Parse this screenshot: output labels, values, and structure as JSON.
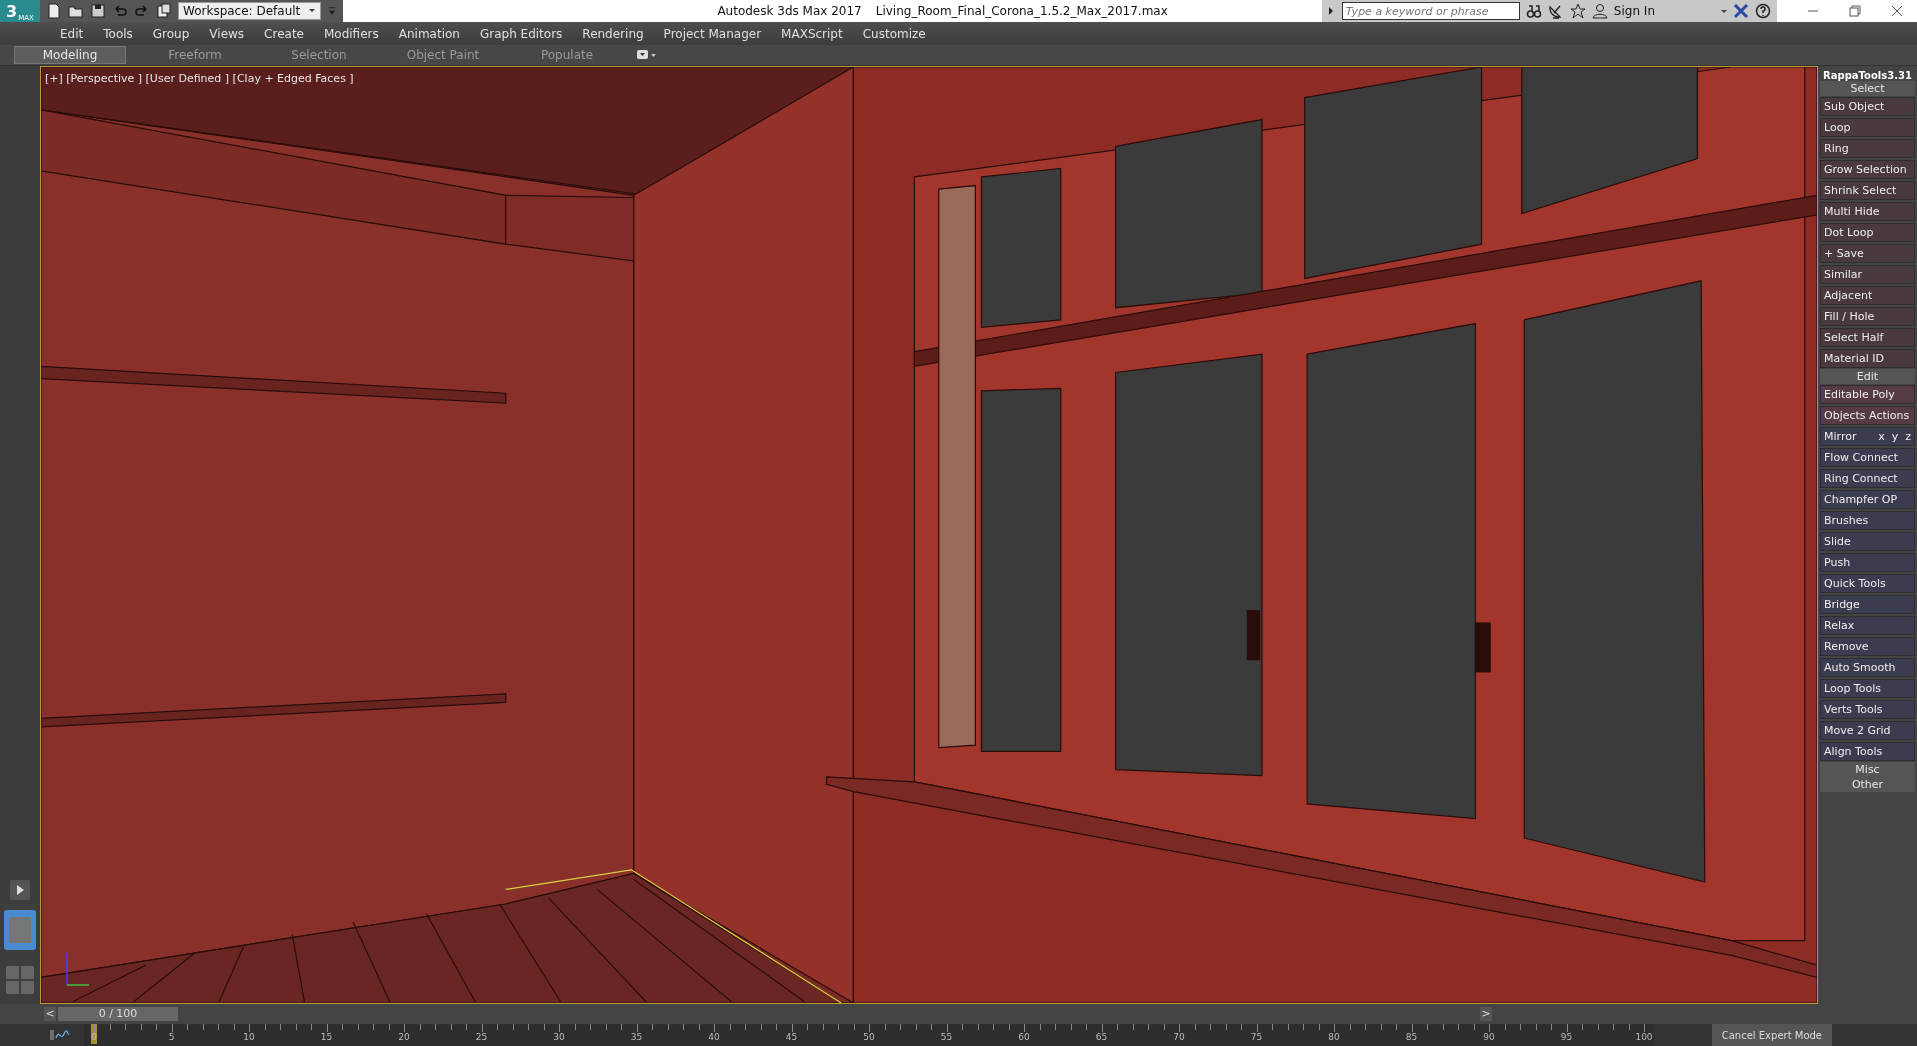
{
  "logo": {
    "numeral": "3",
    "word": "MAX"
  },
  "workspace": {
    "value": "Workspace: Default"
  },
  "title": {
    "app": "Autodesk 3ds Max 2017",
    "file": "Living_Room_Final_Corona_1.5.2_Max_2017.max"
  },
  "search": {
    "placeholder": "Type a keyword or phrase"
  },
  "sign_in": "Sign In",
  "menu": [
    "Edit",
    "Tools",
    "Group",
    "Views",
    "Create",
    "Modifiers",
    "Animation",
    "Graph Editors",
    "Rendering",
    "Project Manager",
    "MAXScript",
    "Customize"
  ],
  "ribbon_tabs": [
    {
      "label": "Modeling",
      "selected": true
    },
    {
      "label": "Freeform",
      "selected": false
    },
    {
      "label": "Selection",
      "selected": false
    },
    {
      "label": "Object Paint",
      "selected": false
    },
    {
      "label": "Populate",
      "selected": false
    }
  ],
  "viewport": {
    "label": "[+] [Perspective ] [User Defined ] [Clay + Edged Faces ]"
  },
  "panel": {
    "title": "RappaTools3.31",
    "items": [
      {
        "kind": "header",
        "label": "Select"
      },
      {
        "kind": "button",
        "label": "Sub Object",
        "color": "#4a3a40"
      },
      {
        "kind": "button",
        "label": "Loop",
        "color": "#4a3a40"
      },
      {
        "kind": "button",
        "label": "Ring",
        "color": "#4a3a40"
      },
      {
        "kind": "button",
        "label": "Grow Selection",
        "color": "#4a3a40"
      },
      {
        "kind": "button",
        "label": "Shrink Select",
        "color": "#4a3a40"
      },
      {
        "kind": "button",
        "label": "Multi Hide",
        "color": "#4a3a40"
      },
      {
        "kind": "button",
        "label": "Dot Loop",
        "color": "#4a3a40"
      },
      {
        "kind": "button",
        "label": "+ Save",
        "color": "#4a3a40"
      },
      {
        "kind": "button",
        "label": "Similar",
        "color": "#4a3a40"
      },
      {
        "kind": "button",
        "label": "Adjacent",
        "color": "#4a3a40"
      },
      {
        "kind": "button",
        "label": "Fill / Hole",
        "color": "#4a3a40"
      },
      {
        "kind": "button",
        "label": "Select Half",
        "color": "#4a3a40"
      },
      {
        "kind": "button",
        "label": "Material ID",
        "color": "#4a3a40"
      },
      {
        "kind": "header",
        "label": "Edit"
      },
      {
        "kind": "button",
        "label": "Editable Poly",
        "color": "#563a48"
      },
      {
        "kind": "button",
        "label": "Objects Actions",
        "color": "#563a48"
      },
      {
        "kind": "axes",
        "label": "Mirror",
        "axes": [
          "x",
          "y",
          "z"
        ],
        "color": "#3c3c50"
      },
      {
        "kind": "button",
        "label": "Flow Connect",
        "color": "#3c3c50"
      },
      {
        "kind": "button",
        "label": "Ring Connect",
        "color": "#3c3c50"
      },
      {
        "kind": "button",
        "label": "Champfer OP",
        "color": "#3c3c50"
      },
      {
        "kind": "button",
        "label": "Brushes",
        "color": "#3c3c50"
      },
      {
        "kind": "button",
        "label": "Slide",
        "color": "#3c3c50"
      },
      {
        "kind": "button",
        "label": "Push",
        "color": "#3c3c50"
      },
      {
        "kind": "button",
        "label": "Quick Tools",
        "color": "#3c3c50"
      },
      {
        "kind": "button",
        "label": "Bridge",
        "color": "#3c3c50"
      },
      {
        "kind": "button",
        "label": "Relax",
        "color": "#3c3c50"
      },
      {
        "kind": "button",
        "label": "Remove",
        "color": "#3c3c50"
      },
      {
        "kind": "button",
        "label": "Auto Smooth",
        "color": "#3c3c50"
      },
      {
        "kind": "button",
        "label": "Loop Tools",
        "color": "#3c3c50"
      },
      {
        "kind": "button",
        "label": "Verts Tools",
        "color": "#3c3c50"
      },
      {
        "kind": "button",
        "label": "Move 2 Grid",
        "color": "#3c3c50"
      },
      {
        "kind": "button",
        "label": "Align Tools",
        "color": "#3c3c50"
      },
      {
        "kind": "header",
        "label": "Misc"
      },
      {
        "kind": "header",
        "label": "Other"
      }
    ]
  },
  "time_slider": {
    "prev": "<",
    "frame": "0 / 100",
    "next": ">",
    "level": 0
  },
  "ruler": [
    "0",
    "5",
    "10",
    "15",
    "20",
    "25",
    "30",
    "35",
    "40",
    "45",
    "50",
    "55",
    "60",
    "65",
    "70",
    "75",
    "80",
    "85",
    "90",
    "95",
    "100"
  ],
  "expert_button": "Cancel Expert Mode"
}
